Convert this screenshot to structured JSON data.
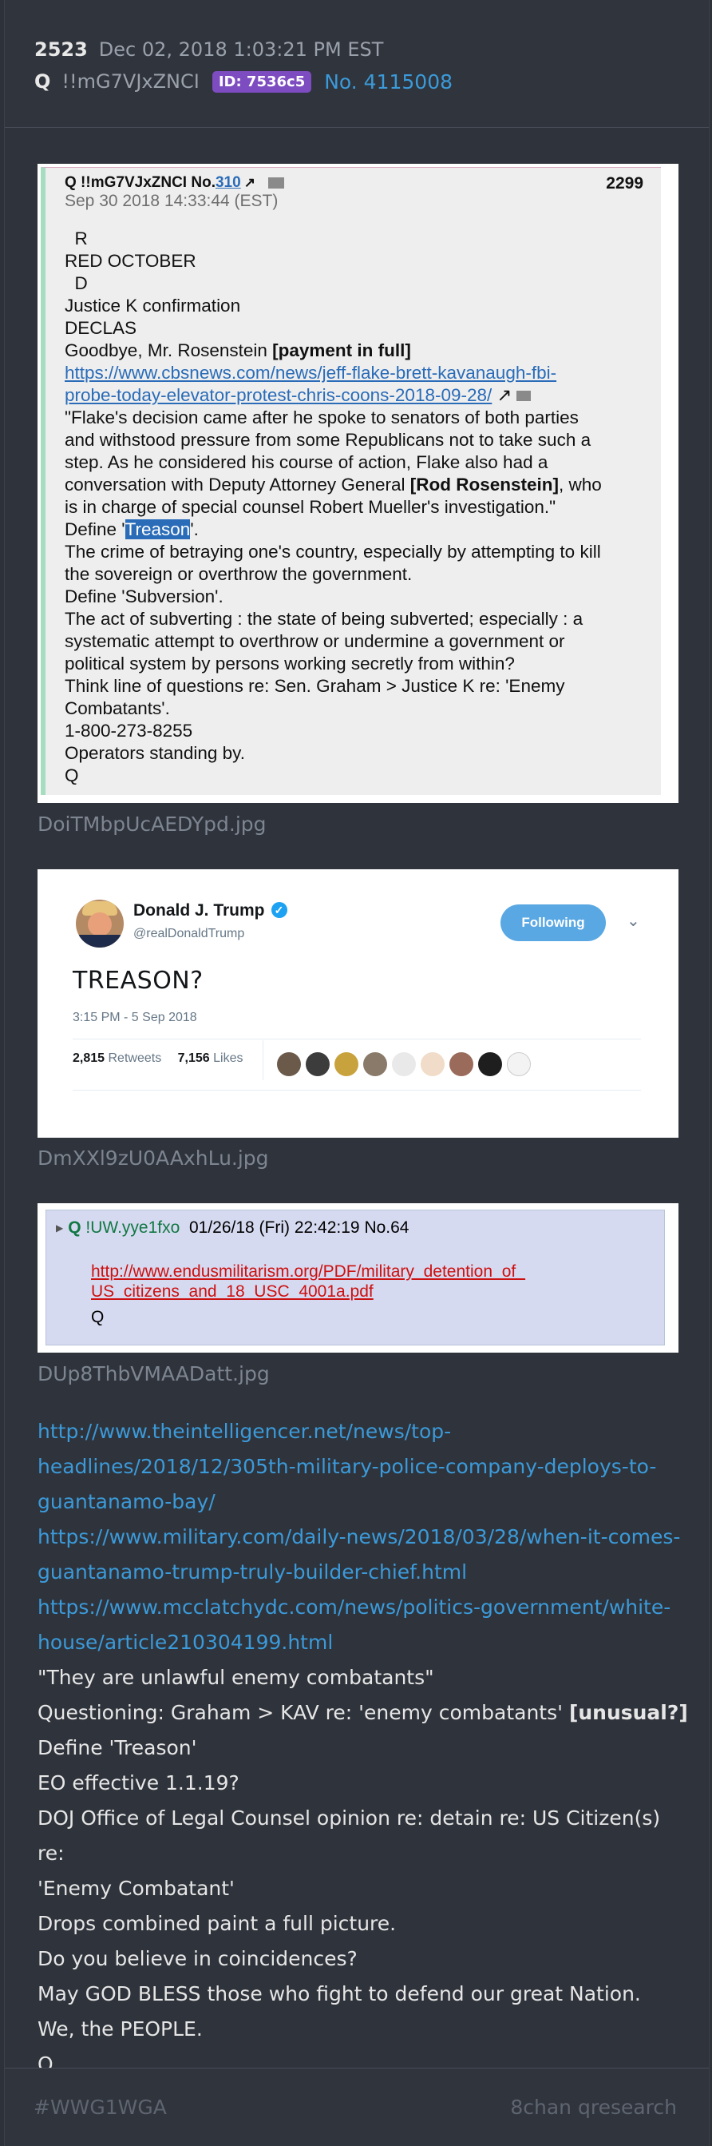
{
  "post": {
    "number": "2523",
    "date": "Dec 02, 2018 1:03:21 PM EST",
    "name": "Q",
    "tripcode": "!!mG7VJxZNCI",
    "id_badge": "ID: 7536c5",
    "post_no": "No. 4115008"
  },
  "images": [
    {
      "filename": "DoiTMbpUcAEDYpd.jpg",
      "header_name": "Q !!mG7VJxZNCI No.",
      "header_ref": "310",
      "header_num": "2299",
      "header_date": "Sep 30 2018 14:33:44 (EST)",
      "lines": {
        "l1": "R",
        "l2": "RED OCTOBER",
        "l3": "D",
        "l4": "Justice K confirmation",
        "l5": "DECLAS",
        "l6a": "Goodbye, Mr. Rosenstein ",
        "l6b": "[payment in full]",
        "l7": "https://www.cbsnews.com/news/jeff-flake-brett-kavanaugh-fbi-",
        "l8": "probe-today-elevator-protest-chris-coons-2018-09-28/",
        "l9": "\"Flake's decision came after he spoke to senators of both parties",
        "l10": "and withstood pressure from some Republicans not to take such a",
        "l11": "step. As he considered his course of action, Flake also had a",
        "l12a": "conversation with Deputy Attorney General ",
        "l12b": "[Rod Rosenstein]",
        "l12c": ", who",
        "l13": "is in charge of special counsel Robert Mueller's investigation.\"",
        "l14a": "Define '",
        "l14b": "Treason",
        "l14c": "'.",
        "l15": "The crime of betraying one's country, especially by attempting to kill",
        "l16": "the sovereign or overthrow the government.",
        "l17": "Define 'Subversion'.",
        "l18": "The act of subverting : the state of being subverted; especially : a",
        "l19": "systematic attempt to overthrow or undermine a government or",
        "l20": "political system by persons working secretly from within?",
        "l21": "Think line of questions re: Sen. Graham > Justice K re: 'Enemy",
        "l22": "Combatants'.",
        "l23": "1-800-273-8255",
        "l24": "Operators standing by.",
        "l25": "Q"
      }
    },
    {
      "filename": "DmXXl9zU0AAxhLu.jpg",
      "tweet_name": "Donald J. Trump",
      "tweet_handle": "@realDonaldTrump",
      "follow_label": "Following",
      "tweet_text": "TREASON?",
      "tweet_time": "3:15 PM - 5 Sep 2018",
      "retweets": "2,815",
      "retweets_label": "Retweets",
      "likes": "7,156",
      "likes_label": "Likes"
    },
    {
      "filename": "DUp8ThbVMAADatt.jpg",
      "name": "Q",
      "trip": "!UW.yye1fxo",
      "datetime": "01/26/18 (Fri) 22:42:19",
      "no": "No.64",
      "link1": "http://www.endusmilitarism.org/PDF/military_detention_of_",
      "link2": "US_citizens_and_18_USC_4001a.pdf",
      "sig": "Q"
    }
  ],
  "body": {
    "url1a": "http://www.theintelligencer.net/news/top-",
    "url1b": "headlines/2018/12/305th-military-police-company-deploys-to-",
    "url1c": "guantanamo-bay/",
    "url2a": "https://www.military.com/daily-news/2018/03/28/when-it-comes-",
    "url2b": "guantanamo-trump-truly-builder-chief.html",
    "url3a": "https://www.mcclatchydc.com/news/politics-government/white-",
    "url3b": "house/article210304199.html",
    "t1": "\"They are unlawful enemy combatants\"",
    "t2a": "Questioning: Graham > KAV re: 'enemy combatants' ",
    "t2b": "[unusual?]",
    "t3": "Define 'Treason'",
    "t4": "EO effective 1.1.19?",
    "t5a": "DOJ Office of Legal Counsel opinion re: detain re: US Citizen(s) re:",
    "t5b": "'Enemy Combatant'",
    "t6": "Drops combined paint a full picture.",
    "t7": "Do you believe in coincidences?",
    "t8": "May GOD BLESS those who fight to defend our great Nation.",
    "t9": "We, the PEOPLE.",
    "t10": "Q"
  },
  "footer": {
    "tag": "#WWG1WGA",
    "source": "8chan qresearch"
  },
  "colors": {
    "background": "#2d3139",
    "link": "#3b9ad9",
    "id_badge": "#7d4cc0",
    "muted": "#5e6570"
  },
  "icons": [
    "external-link-icon",
    "folder-icon",
    "verified-icon",
    "chevron-down-icon",
    "expand-triangle-icon"
  ]
}
